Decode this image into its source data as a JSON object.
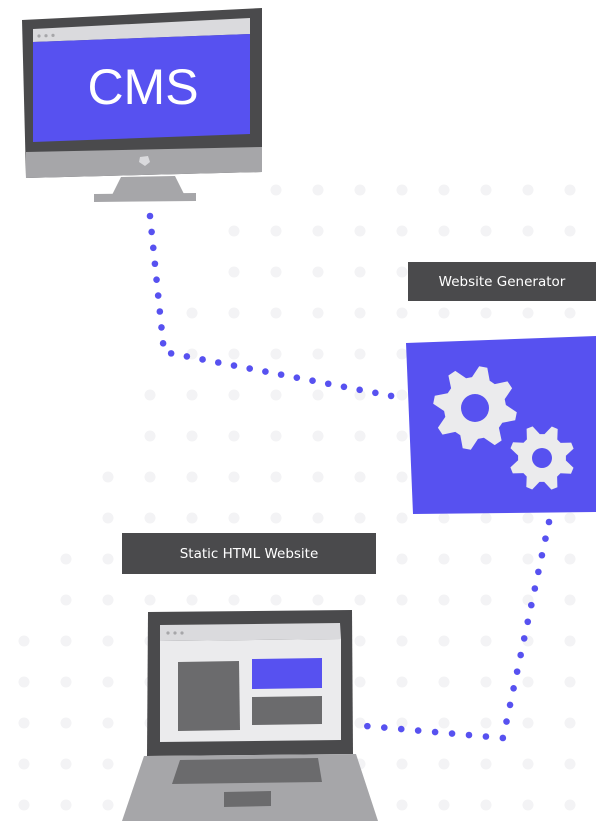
{
  "cms": {
    "screen_text": "CMS"
  },
  "generator": {
    "label": "Website Generator"
  },
  "website": {
    "label": "Static HTML Website"
  },
  "colors": {
    "accent": "#5751f0",
    "device_dark": "#4a4a4c",
    "device_light": "#a6a6a9",
    "bar": "#dadadd",
    "gear": "#ebebed",
    "dot_grid": "#f3f3f5"
  },
  "icons": [
    "desktop-monitor-icon",
    "gears-icon",
    "laptop-icon"
  ]
}
